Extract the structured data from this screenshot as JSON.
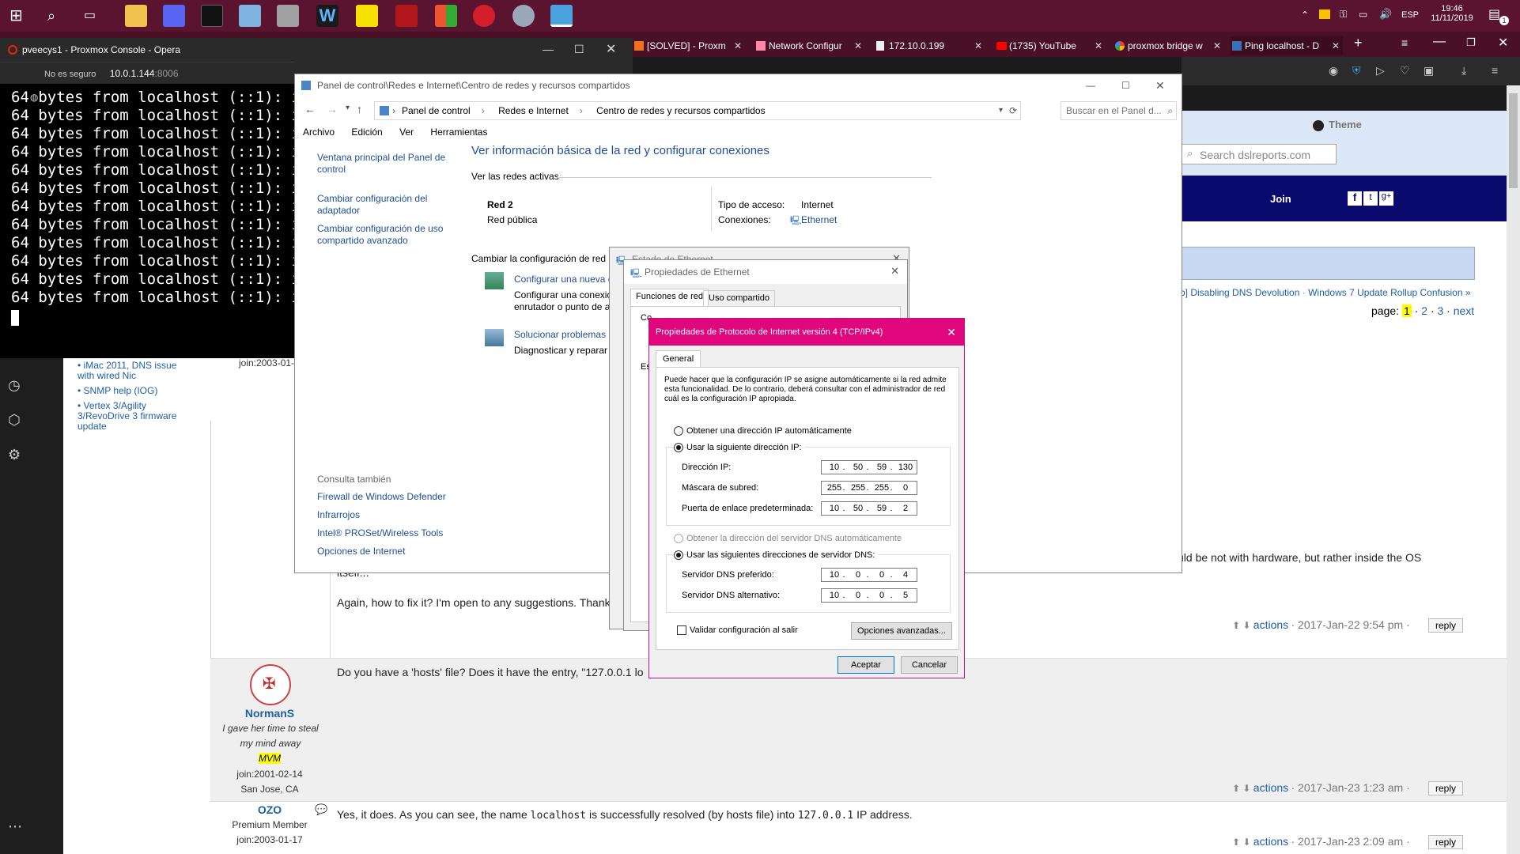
{
  "taskbar": {
    "time": "19:46",
    "date": "11/11/2019",
    "lang": "ESP",
    "notif_count": "1"
  },
  "opera": {
    "tabs": [
      {
        "label": "[SOLVED] - Proxm"
      },
      {
        "label": "Network Configur"
      },
      {
        "label": "172.10.0.199"
      },
      {
        "label": "(1735) YouTube"
      },
      {
        "label": "proxmox bridge w"
      },
      {
        "label": "Ping localhost - D"
      }
    ]
  },
  "console": {
    "title": "pveecys1 - Proxmox Console - Opera",
    "security": "No es seguro",
    "url": "10.0.1.144",
    "url_port": ":8006",
    "lines": [
      "64 bytes from localhost (::1): ic",
      "64 bytes from localhost (::1): ic",
      "64 bytes from localhost (::1): ic",
      "64 bytes from localhost (::1): ic",
      "64 bytes from localhost (::1): ic",
      "64 bytes from localhost (::1): ic",
      "64 bytes from localhost (::1): ic",
      "64 bytes from localhost (::1): ic",
      "64 bytes from localhost (::1): ic",
      "64 bytes from localhost (::1): ic",
      "64 bytes from localhost (::1): ic",
      "64 bytes from localhost (::1): ic"
    ]
  },
  "webpage": {
    "theme_label": "Theme",
    "search_placeholder": "Search dslreports.com",
    "join_label": "Join",
    "breadcrumb_tail1": "b] Disabling DNS Devolution",
    "breadcrumb_tail2": "Windows 7 Update Rollup Confusion »",
    "page_label": "page:",
    "pages": [
      "1",
      "2",
      "3"
    ],
    "next": "next",
    "related": [
      "• iMac 2011, DNS issue with wired Nic",
      "• SNMP help (IOG)",
      "• Vertex 3/Agility 3/RevoDrive 3 firmware update"
    ],
    "post1_join": "join:2003-01-",
    "post1_text_a": "blem could be not with hardware, but rather inside the OS",
    "post1_text_b": "itself...",
    "post1_text_c": "Again, how to fix it? I'm open to any suggestions. Thank yo",
    "post1_actions": "actions",
    "post1_date": "· 2017-Jan-22 9:54 pm ·",
    "reply": "reply",
    "post2_user": "NormanS",
    "post2_tagline": "I gave her time to steal my mind away",
    "post2_badge": "MVM",
    "post2_join": "join:2001-02-14",
    "post2_loc": "San Jose, CA",
    "post2_text": "Do you have a 'hosts' file? Does it have the entry, \"127.0.0.1    lo",
    "post2_actions": "actions",
    "post2_date": "· 2017-Jan-23 1:23 am ·",
    "post3_user": "OZO",
    "post3_rank": "Premium Member",
    "post3_join": "join:2003-01-17",
    "post3_text_a": "Yes, it does. As you can see, the name",
    "post3_code1": "localhost",
    "post3_text_b": "is successfully resolved (by hosts file) into",
    "post3_code2": "127.0.0.1",
    "post3_text_c": "IP address.",
    "post3_actions": "actions",
    "post3_date": "· 2017-Jan-23 2:09 am ·"
  },
  "control_panel": {
    "title": "Panel de control\\Redes e Internet\\Centro de redes y recursos compartidos",
    "crumbs": [
      "Panel de control",
      "Redes e Internet",
      "Centro de redes y recursos compartidos"
    ],
    "search_placeholder": "Buscar en el Panel d...",
    "menu": [
      "Archivo",
      "Edición",
      "Ver",
      "Herramientas"
    ],
    "left_links": [
      "Ventana principal del Panel de control",
      "Cambiar configuración del adaptador",
      "Cambiar configuración de uso compartido avanzado"
    ],
    "see_also": "Consulta también",
    "see_also_links": [
      "Firewall de Windows Defender",
      "Infrarrojos",
      "Intel® PROSet/Wireless Tools",
      "Opciones de Internet"
    ],
    "heading": "Ver información básica de la red y configurar conexiones",
    "active_networks": "Ver las redes activas",
    "net_name": "Red 2",
    "net_type": "Red pública",
    "access_label": "Tipo de acceso:",
    "access_value": "Internet",
    "conn_label": "Conexiones:",
    "conn_value": "Ethernet",
    "change_heading": "Cambiar la configuración de red",
    "task1_link": "Configurar una nueva c",
    "task1_desc": "Configurar una conexió enrutador o punto de a",
    "task2_link": "Solucionar problemas",
    "task2_desc": "Diagnosticar y reparar p"
  },
  "ethernet_status": {
    "title": "Estado de Ethernet"
  },
  "ethernet_props": {
    "title": "Propiedades de Ethernet",
    "tabs": [
      "Funciones de red",
      "Uso compartido"
    ],
    "frag1": "Co",
    "frag2": "Es"
  },
  "tcpip": {
    "title": "Propiedades de Protocolo de Internet versión 4 (TCP/IPv4)",
    "tab": "General",
    "description": "Puede hacer que la configuración IP se asigne automáticamente si la red admite esta funcionalidad. De lo contrario, deberá consultar con el administrador de red cuál es la configuración IP apropiada.",
    "radio_auto_ip": "Obtener una dirección IP automáticamente",
    "radio_manual_ip": "Usar la siguiente dirección IP:",
    "ip_label": "Dirección IP:",
    "ip": [
      "10",
      "50",
      "59",
      "130"
    ],
    "mask_label": "Máscara de subred:",
    "mask": [
      "255",
      "255",
      "255",
      "0"
    ],
    "gw_label": "Puerta de enlace predeterminada:",
    "gw": [
      "10",
      "50",
      "59",
      "2"
    ],
    "radio_auto_dns": "Obtener la dirección del servidor DNS automáticamente",
    "radio_manual_dns": "Usar las siguientes direcciones de servidor DNS:",
    "dns1_label": "Servidor DNS preferido:",
    "dns1": [
      "10",
      "0",
      "0",
      "4"
    ],
    "dns2_label": "Servidor DNS alternativo:",
    "dns2": [
      "10",
      "0",
      "0",
      "5"
    ],
    "validate_label": "Validar configuración al salir",
    "advanced_button": "Opciones avanzadas...",
    "ok_button": "Aceptar",
    "cancel_button": "Cancelar"
  }
}
